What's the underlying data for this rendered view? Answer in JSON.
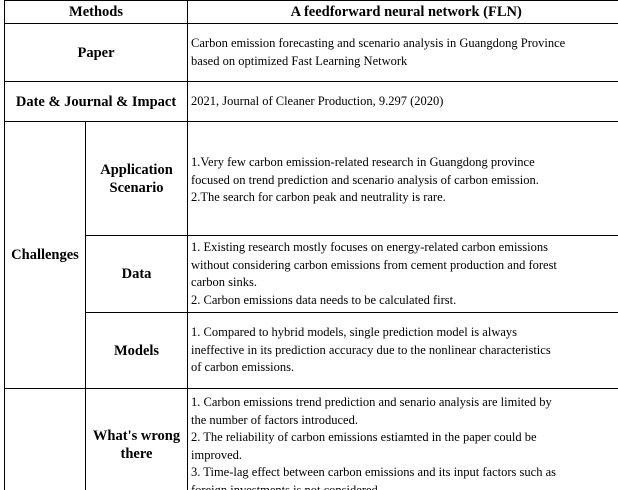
{
  "header": {
    "col1": "Methods",
    "col2": "A feedforward neural network (FLN)"
  },
  "paper": {
    "label": "Paper",
    "lines": [
      "Carbon emission forecasting and scenario analysis in Guangdong Province",
      "based on optimized Fast Learning Network"
    ]
  },
  "date_journal": {
    "label": "Date & Journal & Impact",
    "value": "2021, Journal of Cleaner Production, 9.297 (2020)"
  },
  "challenges": {
    "label": "Challenges",
    "application": {
      "label_lines": [
        "Application",
        "Scenario"
      ],
      "lines": [
        "1.Very few carbon emission-related research in Guangdong province",
        "focused on trend prediction and scenario analysis of carbon emission.",
        "2.The search for carbon peak and neutrality is rare."
      ]
    },
    "data": {
      "label": "Data",
      "lines": [
        "1. Existing research mostly focuses on energy-related carbon emissions",
        "without considering carbon emissions from cement production and forest",
        "carbon sinks.",
        "2. Carbon emissions data needs to be calculated first."
      ]
    },
    "models": {
      "label": "Models",
      "lines": [
        "1. Compared to hybrid models, single prediction model is always",
        "ineffective in its prediction accuracy due to the nonlinear characteristics",
        "of carbon emissions."
      ]
    }
  },
  "whats_wrong": {
    "label_lines": [
      "What's wrong",
      "there"
    ],
    "lines": [
      "1. Carbon emissions trend prediction and senario analysis are limited by",
      "the number of factors introduced.",
      "2. The reliability of carbon emissions estiamted in the paper could be",
      "improved.",
      "3. Time-lag effect between carbon emissions and its input factors such as",
      "foreign investments is not considered."
    ]
  }
}
